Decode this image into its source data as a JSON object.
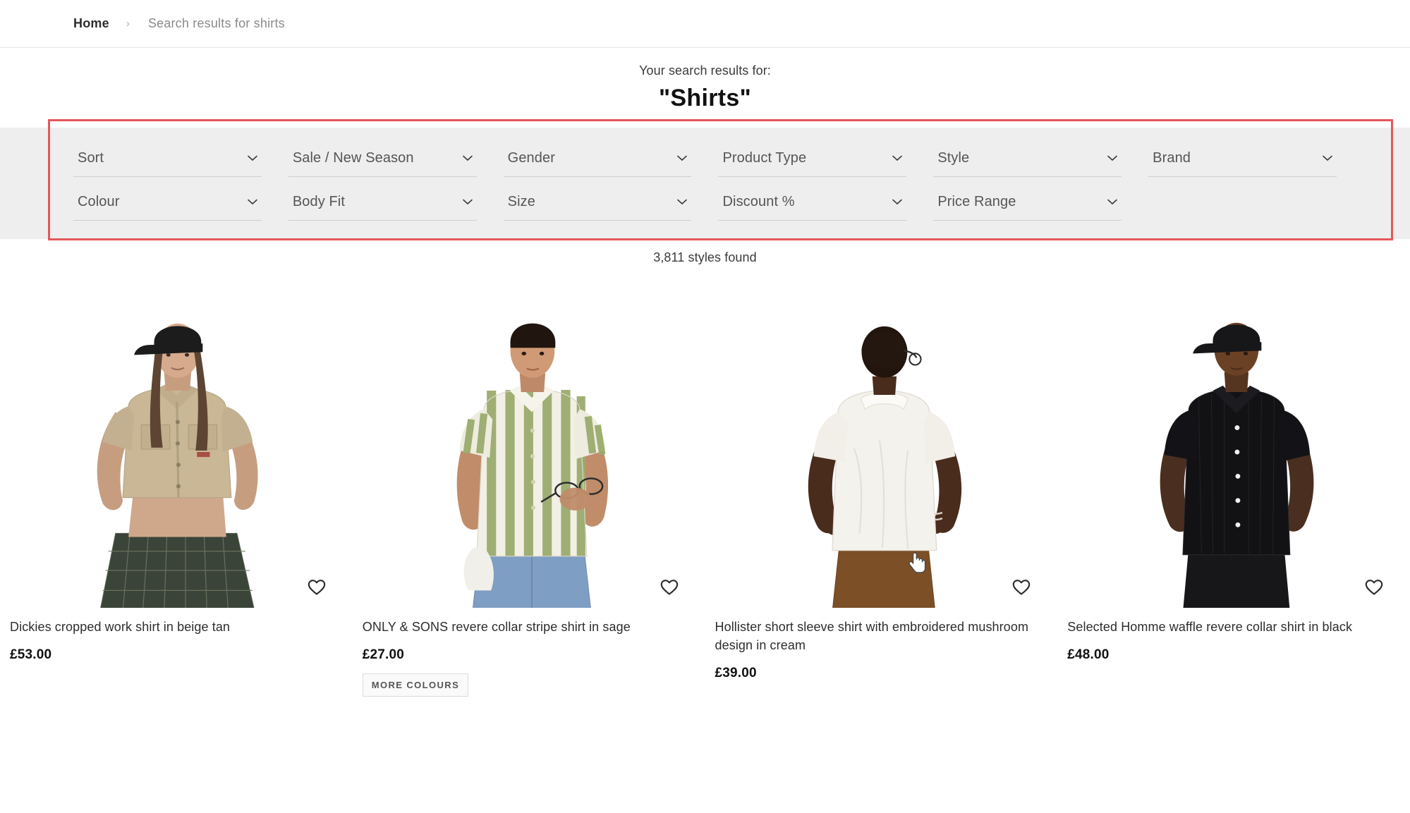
{
  "breadcrumb": {
    "home_label": "Home",
    "separator": "›",
    "current_label": "Search results for shirts"
  },
  "search_header": {
    "subtitle": "Your search results for:",
    "term": "\"Shirts\""
  },
  "filters": {
    "row1": [
      {
        "label": "Sort",
        "icon": "chevron-down-icon"
      },
      {
        "label": "Sale / New Season",
        "icon": "chevron-down-icon"
      },
      {
        "label": "Gender",
        "icon": "chevron-down-icon"
      },
      {
        "label": "Product Type",
        "icon": "chevron-down-icon"
      },
      {
        "label": "Style",
        "icon": "chevron-down-icon"
      },
      {
        "label": "Brand",
        "icon": "chevron-down-icon"
      }
    ],
    "row2": [
      {
        "label": "Colour",
        "icon": "chevron-down-icon"
      },
      {
        "label": "Body Fit",
        "icon": "chevron-down-icon"
      },
      {
        "label": "Size",
        "icon": "chevron-down-icon"
      },
      {
        "label": "Discount %",
        "icon": "chevron-down-icon"
      },
      {
        "label": "Price Range",
        "icon": "chevron-down-icon"
      },
      {
        "label": "",
        "icon": ""
      }
    ],
    "highlight_color": "#e4575c",
    "background_color": "#eeeeee"
  },
  "results": {
    "count_text": "3,811 styles found"
  },
  "products": [
    {
      "title": "Dickies cropped work shirt in beige tan",
      "price": "£53.00",
      "badge": "",
      "save_icon": "heart-icon"
    },
    {
      "title": "ONLY & SONS revere collar stripe shirt in sage",
      "price": "£27.00",
      "badge": "MORE COLOURS",
      "save_icon": "heart-icon"
    },
    {
      "title": "Hollister short sleeve shirt with embroidered mushroom design in cream",
      "price": "£39.00",
      "badge": "",
      "save_icon": "heart-icon"
    },
    {
      "title": "Selected Homme waffle revere collar shirt in black",
      "price": "£48.00",
      "badge": "",
      "save_icon": "heart-icon"
    }
  ]
}
